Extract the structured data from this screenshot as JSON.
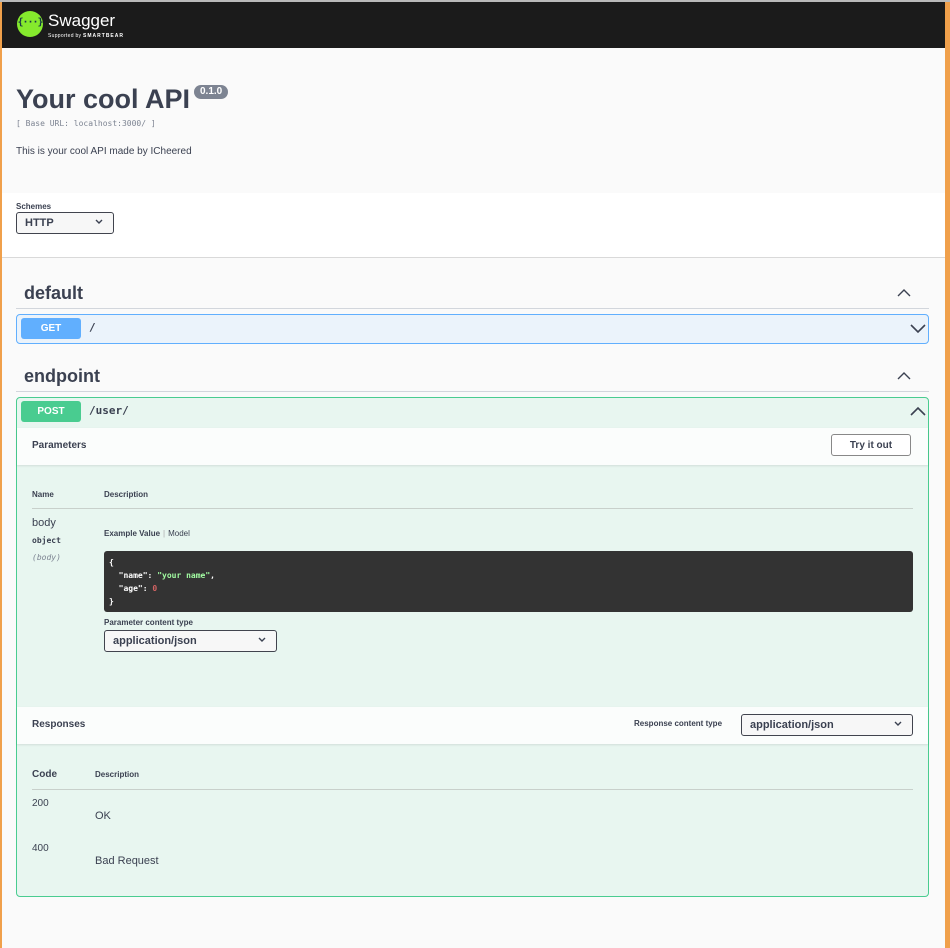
{
  "topbar": {
    "logo_glyph": "{···}",
    "title": "Swagger",
    "supported_by": "Supported by",
    "brand": "SMARTBEAR"
  },
  "info": {
    "title": "Your cool API",
    "version": "0.1.0",
    "base_url": "[ Base URL: localhost:3000/ ]",
    "description": "This is your cool API made by ICheered"
  },
  "schemes": {
    "label": "Schemes",
    "selected": "HTTP"
  },
  "tags": [
    {
      "name": "default",
      "operations": [
        {
          "method": "GET",
          "path": "/"
        }
      ]
    },
    {
      "name": "endpoint",
      "operations": [
        {
          "method": "POST",
          "path": "/user/",
          "parameters": {
            "title": "Parameters",
            "try_label": "Try it out",
            "col_name": "Name",
            "col_description": "Description",
            "rows": [
              {
                "name": "body",
                "type": "object",
                "in": "(body)",
                "tab_example": "Example Value",
                "tab_model": "Model",
                "example": {
                  "open": "{",
                  "name_key": "\"name\"",
                  "name_value": "\"your name\"",
                  "age_key": "\"age\"",
                  "age_value": "0",
                  "close": "}"
                },
                "content_type_label": "Parameter content type",
                "content_type": "application/json"
              }
            ]
          },
          "responses": {
            "title": "Responses",
            "content_type_label": "Response content type",
            "content_type": "application/json",
            "col_code": "Code",
            "col_description": "Description",
            "rows": [
              {
                "code": "200",
                "description": "OK"
              },
              {
                "code": "400",
                "description": "Bad Request"
              }
            ]
          }
        }
      ]
    }
  ],
  "colors": {
    "get": "#61affe",
    "post": "#49cc90",
    "topbar": "#1b1b1b",
    "logo": "#85ea2d"
  }
}
